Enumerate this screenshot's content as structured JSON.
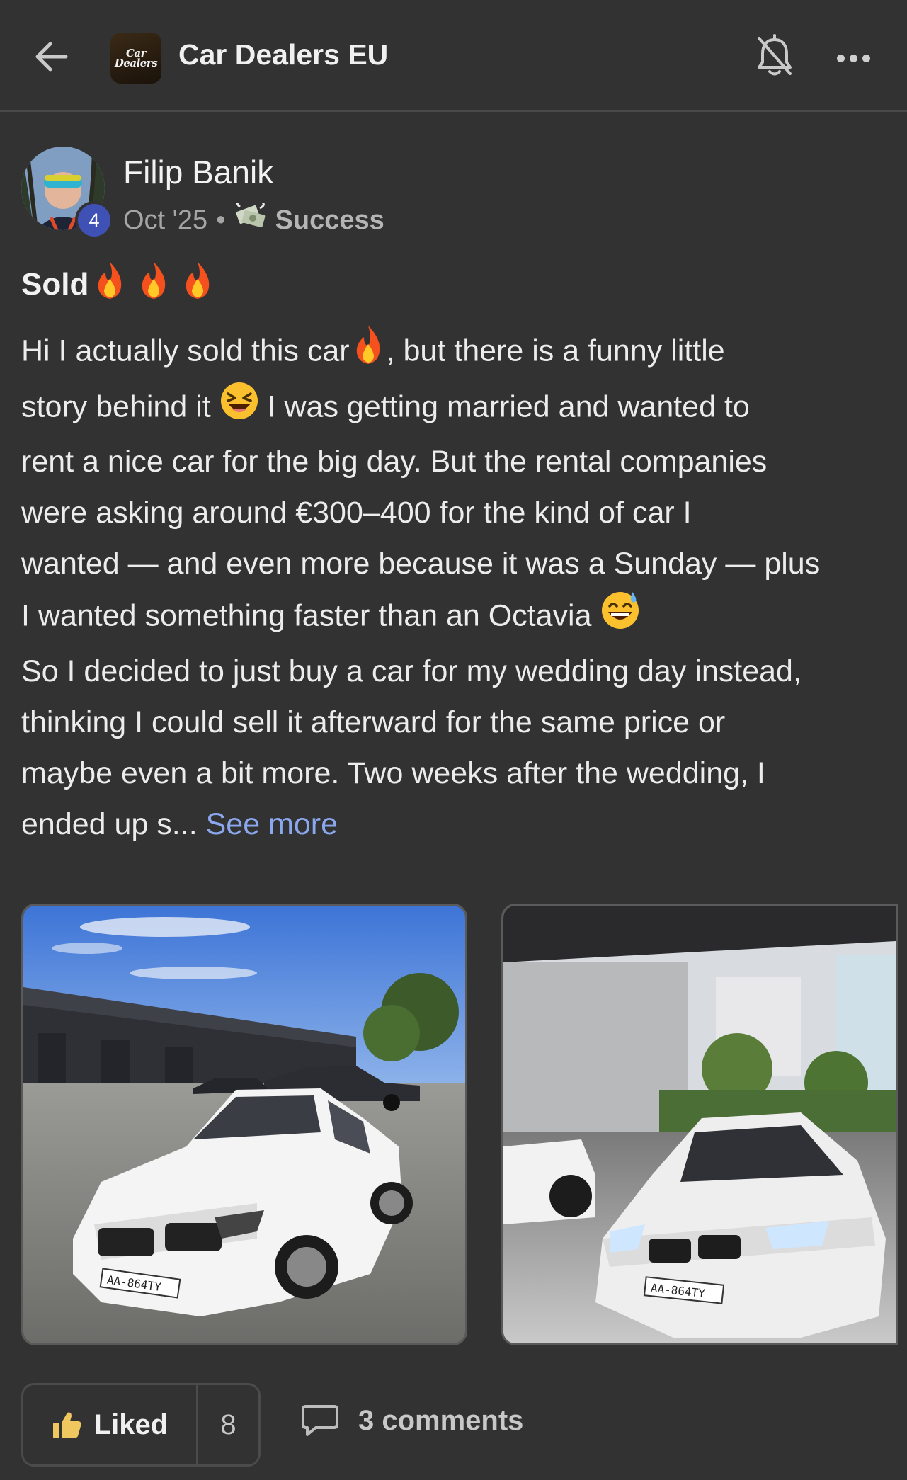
{
  "header": {
    "group_name": "Car Dealers EU",
    "logo_line1": "Car",
    "logo_line2": "Dealers",
    "icons": [
      "back-arrow-icon",
      "bell-off-icon",
      "more-icon"
    ]
  },
  "post": {
    "author": "Filip Banik",
    "author_badge": "4",
    "date": "Oct '25",
    "separator": "•",
    "category": "Success",
    "title": "Sold",
    "body_lines": [
      "Hi I actually sold this car",
      ", but there is a funny little",
      "story behind it",
      " I was getting married and wanted to",
      "rent a nice car for the big day. But the rental companies",
      "were asking around €300–400 for the kind of car I",
      "wanted — and even more because it was a Sunday — plus",
      "I wanted something faster than an Octavia",
      "So I decided to just buy a car for my wedding day instead,",
      "thinking I could sell it afterward for the same price or",
      "maybe even a bit more. Two weeks after the wedding, I",
      "ended up s... "
    ],
    "see_more": "See more",
    "plate": "AA-864TY"
  },
  "actions": {
    "like_label": "Liked",
    "like_count": "8",
    "comments_label": "3 comments"
  },
  "colors": {
    "background": "#323233",
    "accent_link": "#8ba7ee",
    "badge": "#3f51b5"
  }
}
